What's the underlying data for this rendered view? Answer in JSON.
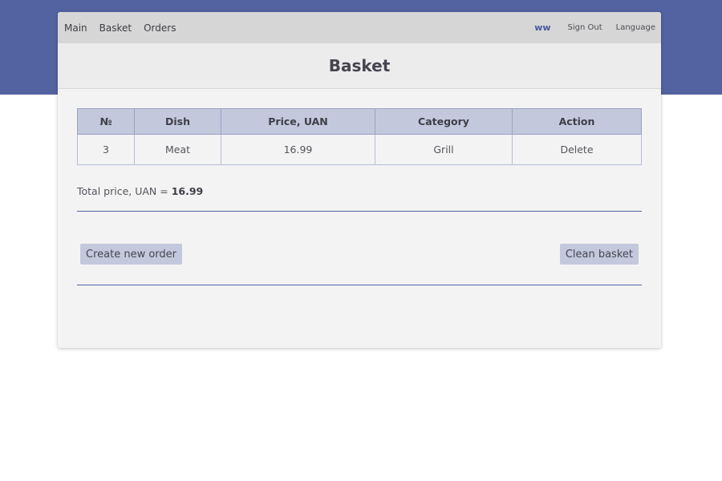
{
  "nav": {
    "links": [
      "Main",
      "Basket",
      "Orders"
    ],
    "user": "ww",
    "sign_out": "Sign Out",
    "language": "Language"
  },
  "page": {
    "title": "Basket"
  },
  "table": {
    "headers": [
      "№",
      "Dish",
      "Price, UAN",
      "Category",
      "Action"
    ],
    "rows": [
      {
        "num": "3",
        "dish": "Meat",
        "price": "16.99",
        "category": "Grill",
        "action": "Delete"
      }
    ]
  },
  "total": {
    "label": "Total price, UAN =",
    "value": "16.99"
  },
  "buttons": {
    "create_order": "Create new order",
    "clean_basket": "Clean basket"
  },
  "colors": {
    "brand": "#5363a1",
    "header_bg": "#c3c8dc",
    "nav_bg": "#d6d6d6"
  }
}
